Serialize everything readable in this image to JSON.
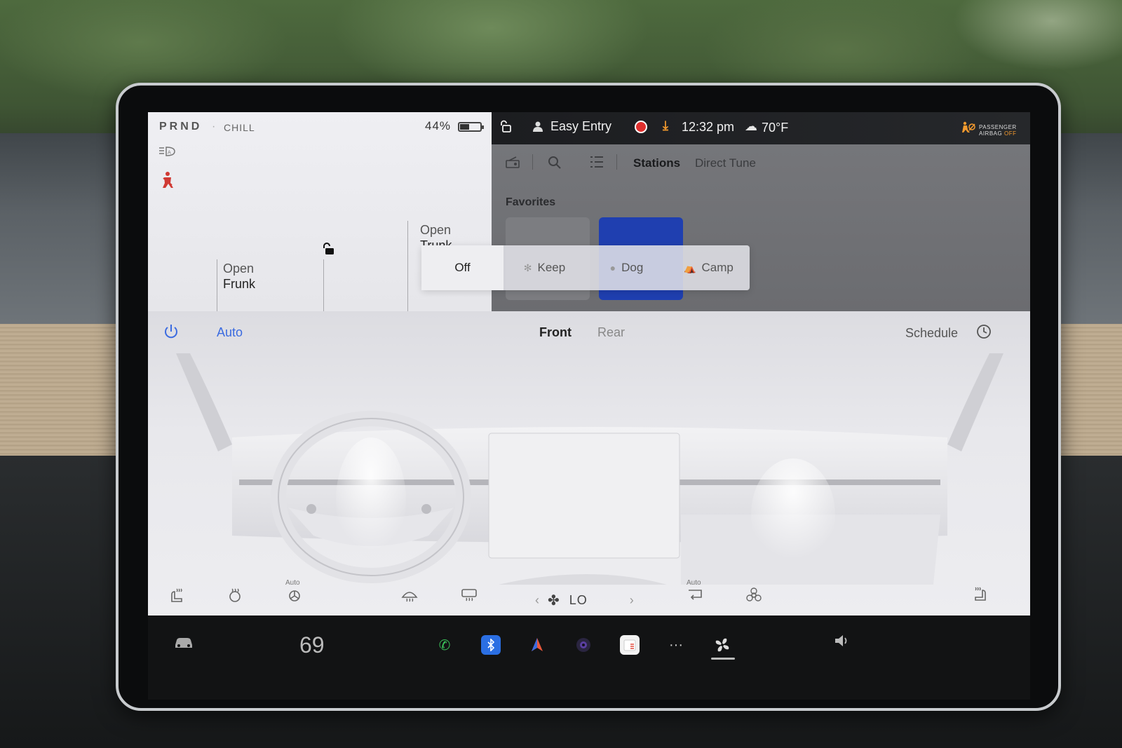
{
  "car_panel": {
    "gear": "PRND",
    "separator": "·",
    "drive_mode": "CHILL",
    "battery_percent": "44%",
    "battery_level": 0.44,
    "open_frunk": {
      "line1": "Open",
      "line2": "Frunk"
    },
    "open_trunk": {
      "line1": "Open",
      "line2": "Trunk"
    }
  },
  "status_bar": {
    "profile_name": "Easy Entry",
    "time": "12:32 pm",
    "temperature": "70°F",
    "airbag_line1": "PASSENGER",
    "airbag_line2": "AIRBAG",
    "airbag_state": "OFF",
    "colors": {
      "record": "#e0302e",
      "download": "#f39a2e",
      "airbag": "#f39a2e"
    }
  },
  "media": {
    "tabs": [
      "Stations",
      "Direct Tune"
    ],
    "active_tab": "Stations",
    "favorites_label": "Favorites"
  },
  "climate_keeper": {
    "options": [
      {
        "label": "Off",
        "icon": ""
      },
      {
        "label": "Keep",
        "icon": "fan-icon"
      },
      {
        "label": "Dog",
        "icon": "paw-icon"
      },
      {
        "label": "Camp",
        "icon": "tent-icon"
      }
    ],
    "selected": "Off"
  },
  "climate": {
    "auto_label": "Auto",
    "tabs": [
      "Front",
      "Rear"
    ],
    "active_tab": "Front",
    "schedule_label": "Schedule",
    "seat_auto_label": "Auto",
    "recirc_auto_label": "Auto",
    "fan_speed": "LO",
    "accent_color": "#3b6be0"
  },
  "dock": {
    "temperature": "69",
    "apps": [
      "phone-icon",
      "bluetooth-icon",
      "navigation-icon",
      "camera-icon",
      "calendar-icon",
      "more-icon",
      "fan-icon"
    ],
    "active_app": "fan-icon"
  }
}
